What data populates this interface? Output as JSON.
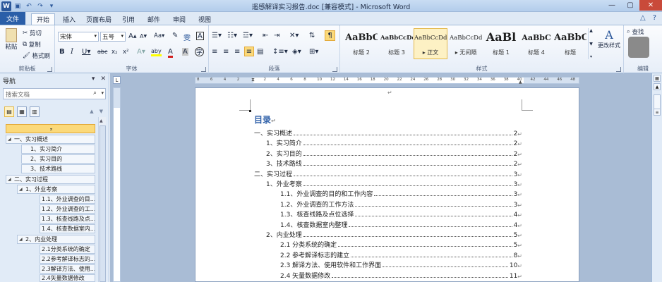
{
  "window": {
    "title": "遥感解译实习报告.doc [兼容模式] - Microsoft Word",
    "app_icon": "W",
    "quick_access": [
      "save-icon",
      "undo-icon",
      "redo-icon",
      "customize-icon"
    ]
  },
  "tabs": [
    "文件",
    "开始",
    "插入",
    "页面布局",
    "引用",
    "邮件",
    "审阅",
    "视图"
  ],
  "active_tab": "开始",
  "ribbon": {
    "clipboard": {
      "label": "剪贴板",
      "paste": "粘贴",
      "cut": "剪切",
      "copy": "复制",
      "format_painter": "格式刷"
    },
    "font": {
      "label": "字体",
      "font_name": "宋体",
      "font_size": "五号",
      "grow": "A",
      "shrink": "A",
      "change_case": "Aa",
      "wen": "雯",
      "border_a": "A",
      "bold": "B",
      "italic": "I",
      "underline": "U",
      "strike": "abc",
      "subscript": "x₂",
      "superscript": "x²",
      "highlight": "aby",
      "font_color": "A",
      "char_shade": "A",
      "enclose": "字"
    },
    "paragraph": {
      "label": "段落"
    },
    "styles": {
      "label": "样式",
      "items": [
        {
          "preview": "AaBbC",
          "name": "标题 2"
        },
        {
          "preview": "AaBbCcDd",
          "name": "标题 3"
        },
        {
          "preview": "AaBbCcDd",
          "name": "正文"
        },
        {
          "preview": "AaBbCcDd",
          "name": "无间隔"
        },
        {
          "preview": "AaBl",
          "name": "标题 1"
        },
        {
          "preview": "AaBbC",
          "name": "标题 4"
        },
        {
          "preview": "AaBbC",
          "name": "标题"
        }
      ],
      "selected": 2,
      "change_styles": "更改样式"
    },
    "editing": {
      "label": "编辑",
      "find": "查找"
    }
  },
  "nav": {
    "title": "导航",
    "search_placeholder": "搜索文档",
    "items": [
      {
        "text": "",
        "level": 0,
        "highlight": true
      },
      {
        "text": "一、实习概述",
        "level": 0
      },
      {
        "text": "1、实习简介",
        "level": 1
      },
      {
        "text": "2、实习目的",
        "level": 1
      },
      {
        "text": "3、技术路线",
        "level": 1
      },
      {
        "text": "二、实习过程",
        "level": 0
      },
      {
        "text": "1、外业考察",
        "level": 1
      },
      {
        "text": "1.1、外业调查的目...",
        "level": 2
      },
      {
        "text": "1.2、外业调查的工...",
        "level": 2
      },
      {
        "text": "1.3、核查线路及点...",
        "level": 2
      },
      {
        "text": "1.4、核查数据室内...",
        "level": 2
      },
      {
        "text": "2、内业处理",
        "level": 1
      },
      {
        "text": "2.1分类系统的确定",
        "level": 2
      },
      {
        "text": "2.2参考解译标志的...",
        "level": 2
      },
      {
        "text": "2.3解译方法、使用...",
        "level": 2
      },
      {
        "text": "2.4矢量数据修改",
        "level": 2
      }
    ]
  },
  "ruler": {
    "ticks": [
      "8",
      "6",
      "4",
      "2",
      "",
      "2",
      "4",
      "6",
      "8",
      "10",
      "12",
      "14",
      "16",
      "18",
      "20",
      "22",
      "24",
      "26",
      "28",
      "30",
      "32",
      "34",
      "36",
      "38",
      "40",
      "42",
      "44",
      "46",
      "48"
    ]
  },
  "doc": {
    "toc_title": "目录",
    "entries": [
      {
        "text": "一、实习概述",
        "page": "2",
        "indent": 0
      },
      {
        "text": "1、实习简介",
        "page": "2",
        "indent": 1
      },
      {
        "text": "2、实习目的",
        "page": "2",
        "indent": 1
      },
      {
        "text": "3、技术路线",
        "page": "2",
        "indent": 1
      },
      {
        "text": "二、实习过程",
        "page": "3",
        "indent": 0
      },
      {
        "text": "1、外业考察",
        "page": "3",
        "indent": 1
      },
      {
        "text": "1.1、外业调查的目的和工作内容",
        "page": "3",
        "indent": 2
      },
      {
        "text": "1.2、外业调查的工作方法",
        "page": "3",
        "indent": 2
      },
      {
        "text": "1.3、核查线路及点位选择",
        "page": "4",
        "indent": 2
      },
      {
        "text": "1.4、核查数据室内整理",
        "page": "4",
        "indent": 2
      },
      {
        "text": "2、内业处理",
        "page": "5",
        "indent": 1
      },
      {
        "text": "2.1 分类系统的确定",
        "page": "5",
        "indent": 2
      },
      {
        "text": "2.2 参考解译标志的建立",
        "page": "8",
        "indent": 2
      },
      {
        "text": "2.3 解译方法、使用软件和工作界面",
        "page": "10",
        "indent": 2
      },
      {
        "text": "2.4 矢量数据修改",
        "page": "11",
        "indent": 2
      }
    ]
  }
}
